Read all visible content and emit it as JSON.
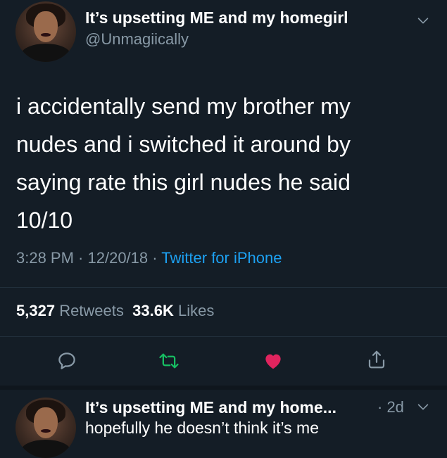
{
  "tweet": {
    "display_name": "It’s upsetting ME and my homegirl",
    "handle": "@Unmagiically",
    "text_lines": [
      "i accidentally send my brother my",
      "nudes and i switched it around by",
      "saying rate this girl nudes he said",
      "10/10"
    ],
    "time": "3:28 PM",
    "separator": " · ",
    "date": "12/20/18",
    "source": "Twitter for iPhone",
    "retweets_count": "5,327",
    "retweets_label": "Retweets",
    "likes_count": "33.6K",
    "likes_label": "Likes"
  },
  "actions": {
    "reply_icon": "reply-icon",
    "retweet_icon": "retweet-icon",
    "like_icon": "heart-icon",
    "share_icon": "share-icon"
  },
  "reply": {
    "display_name": "It’s upsetting ME and my home...",
    "time": "· 2d",
    "text": "hopefully he doesn’t think it’s me"
  },
  "colors": {
    "background": "#141d26",
    "secondary_text": "#8899a6",
    "link": "#1da1f2",
    "retweet": "#17bf63",
    "like": "#e0245e"
  }
}
